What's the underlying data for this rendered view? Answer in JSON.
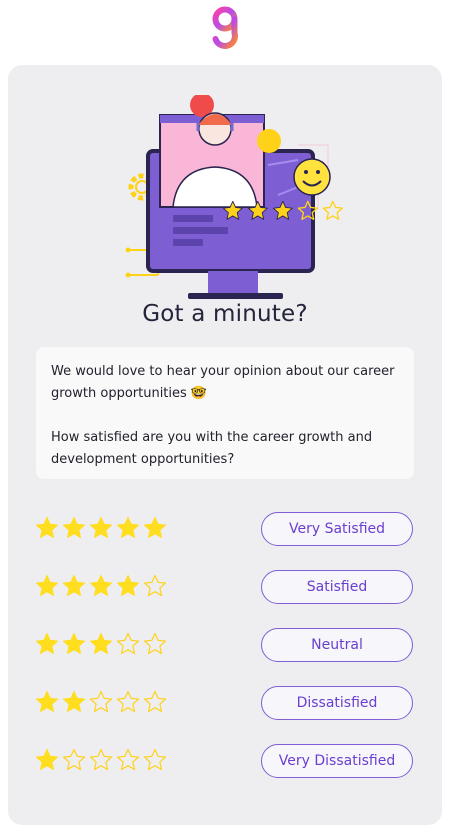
{
  "brand": {
    "logo_icon": "brand-logo-icon",
    "accent": "#7b4fe0"
  },
  "survey": {
    "title": "Got a minute?",
    "message": {
      "intro": "We would love to hear your opinion about our career growth opportunities 🤓",
      "question": "How satisfied are you with the career growth and development opportunities?"
    },
    "options": [
      {
        "label": "Very Satisfied",
        "stars": 5
      },
      {
        "label": "Satisfied",
        "stars": 4
      },
      {
        "label": "Neutral",
        "stars": 3
      },
      {
        "label": "Dissatisfied",
        "stars": 2
      },
      {
        "label": "Very Dissatisfied",
        "stars": 1
      }
    ],
    "max_stars": 5,
    "colors": {
      "star_fill": "#ffdd1f",
      "star_outline": "#ffd21a",
      "button_border": "#7d5fd6",
      "button_text": "#6a3fd0"
    }
  },
  "illustration": {
    "icon": "customer-support-monitor-illustration",
    "rating_stars": 3
  }
}
